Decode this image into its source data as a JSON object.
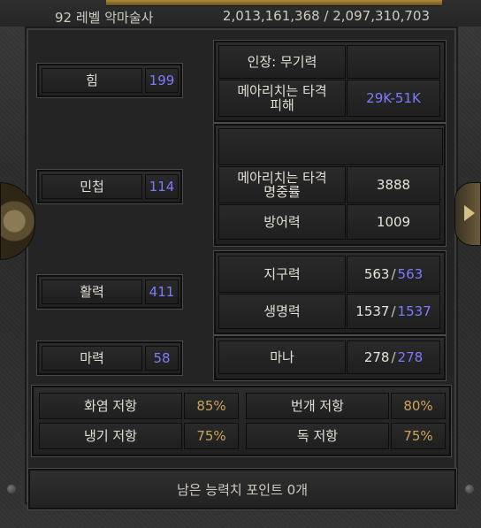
{
  "header": {
    "level_class": "92 레벨 악마술사",
    "experience": "2,013,161,368 / 2,097,310,703"
  },
  "attributes": [
    {
      "key": "strength",
      "label": "힘",
      "value": "199"
    },
    {
      "key": "dexterity",
      "label": "민첩",
      "value": "114"
    },
    {
      "key": "vitality",
      "label": "활력",
      "value": "411"
    },
    {
      "key": "energy",
      "label": "마력",
      "value": "58"
    }
  ],
  "weapon": {
    "title": "인장: 무기력",
    "damage_label": "메아리치는 타격\n피해",
    "damage_value": "29K-51K",
    "accuracy_label": "메아리치는 타격\n명중률",
    "accuracy_value": "3888"
  },
  "defense": {
    "label": "방어력",
    "value": "1009"
  },
  "stamina": {
    "label": "지구력",
    "current": "563",
    "max": "563"
  },
  "life": {
    "label": "생명력",
    "current": "1537",
    "max": "1537"
  },
  "mana": {
    "label": "마나",
    "current": "278",
    "max": "278"
  },
  "resistances": [
    {
      "key": "fire",
      "label": "화염 저항",
      "value": "85%"
    },
    {
      "key": "lightning",
      "label": "번개 저항",
      "value": "80%"
    },
    {
      "key": "cold",
      "label": "냉기 저항",
      "value": "75%"
    },
    {
      "key": "poison",
      "label": "독 저항",
      "value": "75%"
    }
  ],
  "footer": {
    "remaining_points": "남은 능력치 포인트 0개"
  }
}
